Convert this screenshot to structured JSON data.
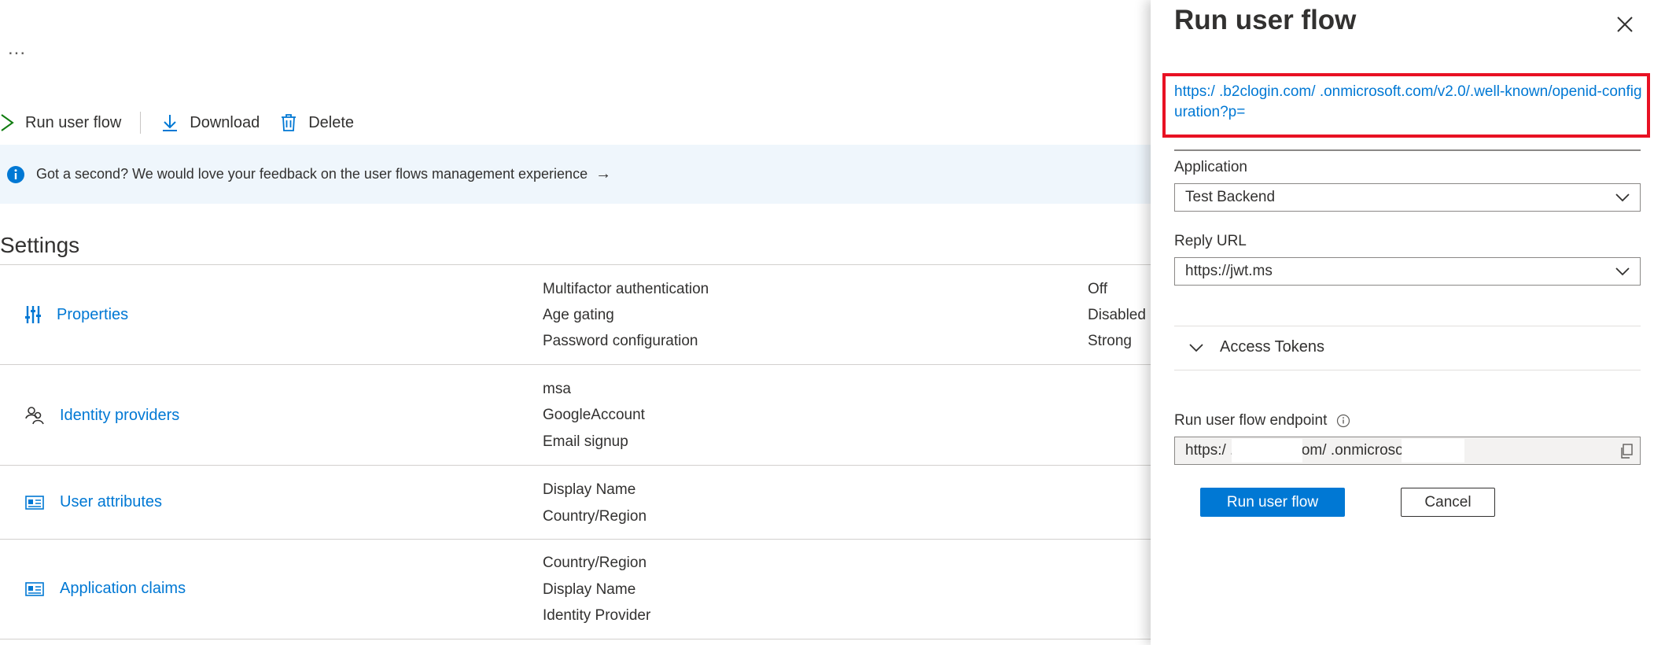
{
  "header": {
    "more_label": "..."
  },
  "toolbar": {
    "run_label": "Run user flow",
    "download_label": "Download",
    "delete_label": "Delete"
  },
  "banner": {
    "text": "Got a second? We would love your feedback on the user flows management experience",
    "arrow": "→"
  },
  "settings": {
    "title": "Settings",
    "rows": [
      {
        "label": "Properties",
        "values": [
          "Multifactor authentication",
          "Age gating",
          "Password configuration"
        ],
        "states": [
          "Off",
          "Disabled",
          "Strong"
        ]
      },
      {
        "label": "Identity providers",
        "values": [
          "msa",
          "GoogleAccount",
          "Email signup"
        ]
      },
      {
        "label": "User attributes",
        "values": [
          "Display Name",
          "Country/Region"
        ]
      },
      {
        "label": "Application claims",
        "values": [
          "Country/Region",
          "Display Name",
          "Identity Provider"
        ]
      }
    ]
  },
  "panel": {
    "title": "Run user flow",
    "wellknown_url": "https:/               .b2clogin.com/               .onmicrosoft.com/v2.0/.well-known/openid-configuration?p=",
    "application_label": "Application",
    "application_value": "Test Backend",
    "reply_url_label": "Reply URL",
    "reply_url_value": "https://jwt.ms",
    "access_tokens_label": "Access Tokens",
    "endpoint_label": "Run user flow endpoint",
    "endpoint_value": "https:/                    .b2clogin.com/                    .onmicrosoft.com/...",
    "run_button": "Run user flow",
    "cancel_button": "Cancel"
  },
  "colors": {
    "link": "#0078d4",
    "highlight": "#e81123",
    "banner_bg": "#eff6fc"
  }
}
